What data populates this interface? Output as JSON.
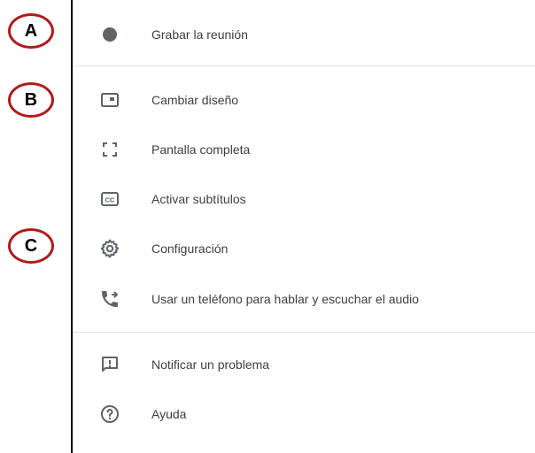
{
  "annotations": {
    "a": "A",
    "b": "B",
    "c": "C"
  },
  "menu": {
    "items": [
      {
        "label": "Grabar la reunión",
        "icon": "record-dot-icon"
      },
      {
        "label": "Cambiar diseño",
        "icon": "change-layout-icon"
      },
      {
        "label": "Pantalla completa",
        "icon": "fullscreen-icon"
      },
      {
        "label": "Activar subtítulos",
        "icon": "closed-captions-icon"
      },
      {
        "label": "Configuración",
        "icon": "gear-icon"
      },
      {
        "label": "Usar un teléfono para hablar y escuchar el audio",
        "icon": "phone-forward-icon"
      },
      {
        "label": "Notificar un problema",
        "icon": "feedback-icon"
      },
      {
        "label": "Ayuda",
        "icon": "help-icon"
      }
    ]
  },
  "colors": {
    "text": "#3c4043",
    "icon": "#5f6368",
    "badge_border": "#b21a1a",
    "divider": "#e3e3e3"
  }
}
